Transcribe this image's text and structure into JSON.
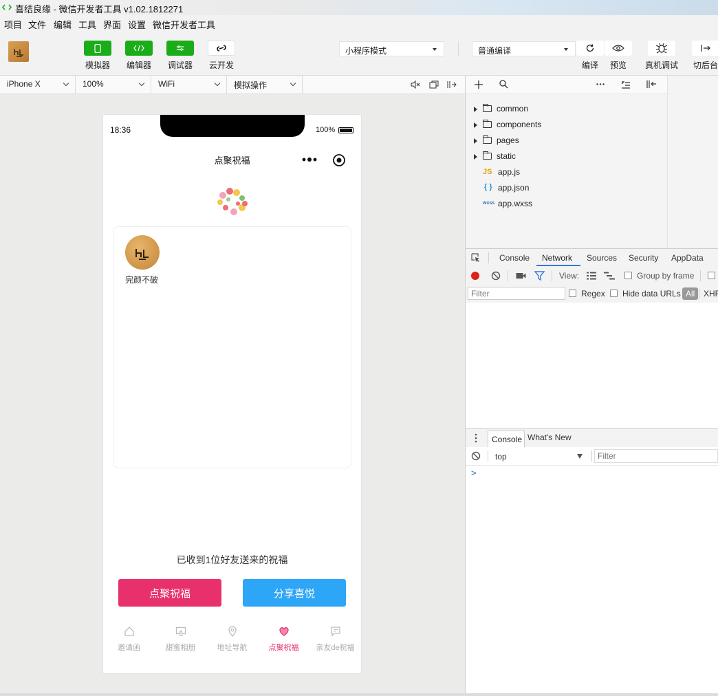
{
  "window": {
    "title": "喜结良缘 - 微信开发者工具 v1.02.1812271"
  },
  "menu": [
    "项目",
    "文件",
    "编辑",
    "工具",
    "界面",
    "设置",
    "微信开发者工具"
  ],
  "toolbar": {
    "simulator": "模拟器",
    "editor": "编辑器",
    "debugger": "调试器",
    "cloud": "云开发",
    "mode": "小程序模式",
    "compile_mode": "普通编译",
    "compile": "编译",
    "preview": "预览",
    "remote_debug": "真机调试",
    "background": "切后台"
  },
  "simbar": {
    "device": "iPhone X",
    "zoom": "100%",
    "network": "WiFi",
    "action": "模拟操作"
  },
  "filetree": [
    {
      "name": "common",
      "type": "folder"
    },
    {
      "name": "components",
      "type": "folder"
    },
    {
      "name": "pages",
      "type": "folder"
    },
    {
      "name": "static",
      "type": "folder"
    },
    {
      "name": "app.js",
      "type": "js",
      "badge": "JS"
    },
    {
      "name": "app.json",
      "type": "json",
      "badge": "{ }"
    },
    {
      "name": "app.wxss",
      "type": "wxss",
      "badge": "wxss"
    }
  ],
  "devtools": {
    "tabs": [
      "Console",
      "Network",
      "Sources",
      "Security",
      "AppData"
    ],
    "active_tab": "Network",
    "view_label": "View:",
    "group_by_frame": "Group by frame",
    "filter_placeholder": "Filter",
    "regex": "Regex",
    "hide_data_urls": "Hide data URLs",
    "all": "All",
    "xhr": "XHR"
  },
  "drawer": {
    "tabs": [
      "Console",
      "What's New"
    ],
    "context": "top",
    "filter_placeholder": "Filter",
    "prompt": ">"
  },
  "phone": {
    "time": "18:36",
    "battery": "100%",
    "nav_title": "点聚祝福",
    "user_name": "完颜不破",
    "summary": "已收到1位好友送来的祝福",
    "btn_left": "点聚祝福",
    "btn_right": "分享喜悦",
    "tabs": [
      {
        "label": "邀请函",
        "icon": "home-icon"
      },
      {
        "label": "甜蜜相册",
        "icon": "photo-icon"
      },
      {
        "label": "地址导航",
        "icon": "location-icon"
      },
      {
        "label": "点聚祝福",
        "icon": "heart-icon",
        "active": true
      },
      {
        "label": "亲友de祝福",
        "icon": "message-icon"
      }
    ],
    "colors": {
      "btn_left": "#e8306c",
      "btn_right": "#2ea6f7",
      "tab_active": "#e8306c"
    }
  }
}
